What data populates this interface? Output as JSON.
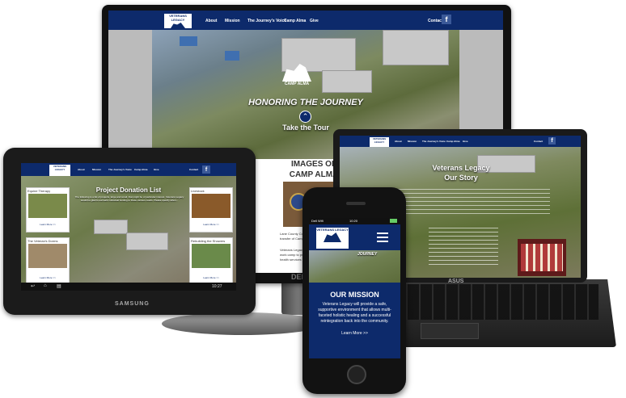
{
  "nav": {
    "logo_text": "VETERANS LEGACY",
    "items": [
      "About",
      "Mission",
      "The Journey's Voice",
      "Camp Alma",
      "Give"
    ],
    "contact": "Contact",
    "facebook": "f"
  },
  "monitor": {
    "hero_badge": "CAMP ALMA",
    "hero_title": "HONORING THE JOURNEY",
    "hero_cta": "Take the Tour",
    "images_title_1": "IMAGES OF",
    "images_title_2": "CAMP ALMA",
    "caption_1": "Lane County Comm",
    "caption_2": "transfer of Camp",
    "caption_3": "Veterans Legacy h",
    "caption_4": "work camp to provid",
    "caption_5": "health services fo",
    "brand_mark": "DEL"
  },
  "laptop": {
    "title_1": "Veterans Legacy",
    "title_2": "Our Story",
    "brand": "ASUS"
  },
  "tablet": {
    "page_title": "Project Donation List",
    "intro": "The following is a list of projects, large and small, that might be of particular interest. Veterans Legacy would be glad to earmark individual funding to these various needs. Please specify when...",
    "cards": [
      {
        "title": "Equine Therapy",
        "more": "Learn More >>"
      },
      {
        "title": "Livestock",
        "more": "Learn More >>"
      },
      {
        "title": "The Veteran's Dorms",
        "more": "Learn More >>"
      },
      {
        "title": "Rebuilding the Showers",
        "more": "Learn More >>"
      }
    ],
    "brand": "SAMSUNG",
    "clock": "10:27"
  },
  "phone": {
    "carrier": "Dell Wifi",
    "time": "10:20",
    "logo_text": "VETERANS LEGACY",
    "banner_word": "JOURNEY",
    "mission_title": "OUR MISSION",
    "mission_text": "Veterans Legacy will provide a safe, supportive environment that allows multi-faceted holistic healing and a successful reintegration back into the community.",
    "learn_more": "Learn More >>"
  },
  "colors": {
    "brand_navy": "#0d2a6b",
    "white": "#ffffff"
  }
}
